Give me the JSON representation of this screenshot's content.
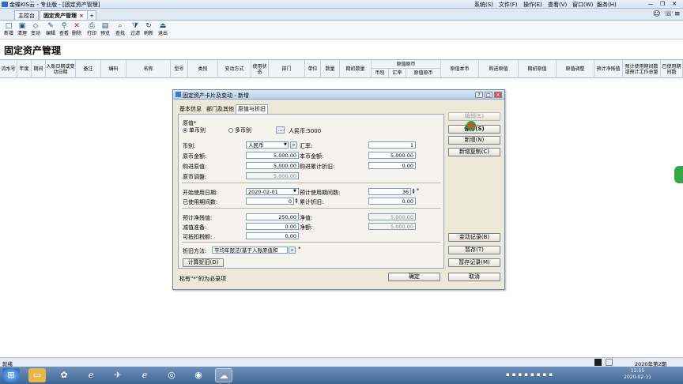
{
  "window": {
    "title": "金蝶KIS云 - 专业版 - [固定资产管理]",
    "menu": [
      "系统(S)",
      "文件(F)",
      "操作(E)",
      "查看(V)",
      "窗口(W)",
      "服务(H)"
    ]
  },
  "tabs": [
    {
      "label": "主控台"
    },
    {
      "label": "固定资产管理",
      "close": "×"
    }
  ],
  "toolbar": [
    {
      "label": "新增",
      "icon": "new-icon"
    },
    {
      "label": "清理",
      "icon": "clear-icon"
    },
    {
      "label": "变动",
      "icon": "change-icon"
    },
    {
      "label": "编辑",
      "icon": "edit-icon"
    },
    {
      "label": "查看",
      "icon": "view-icon"
    },
    {
      "label": "删除",
      "icon": "delete-icon"
    },
    {
      "label": "打印",
      "icon": "print-icon"
    },
    {
      "label": "预览",
      "icon": "preview-icon"
    },
    {
      "label": "查找",
      "icon": "find-icon"
    },
    {
      "label": "过滤",
      "icon": "filter-icon"
    },
    {
      "label": "刷新",
      "icon": "refresh-icon"
    },
    {
      "label": "退出",
      "icon": "exit-icon"
    }
  ],
  "page": {
    "title": "固定资产管理"
  },
  "grid": {
    "columns": [
      "流水号",
      "年度",
      "期间",
      "入账日期或变动日期",
      "备注",
      "编码",
      "名称",
      "型号",
      "类别",
      "变动方式",
      "使用状态",
      "部门",
      "单位",
      "数量",
      "期初数量",
      "原值原币",
      "原值本币",
      "购进原值",
      "期初原值",
      "原值调整",
      "预计净残值",
      "预计使用期间数或预计工作总量",
      "已使用期间数"
    ],
    "sub_columns": [
      "币别",
      "汇率",
      "原值原币"
    ]
  },
  "dialog": {
    "title": "固定资产卡片及变动 - 新增",
    "tabs": [
      "基本信息",
      "部门及其他",
      "原值与折旧"
    ],
    "section_label": "原值*",
    "radio_single": "单币别",
    "radio_multi": "多币别",
    "currency_summary": "人民币:5000",
    "labels": {
      "currency": "币别:",
      "exchange_rate": "汇率:",
      "orig_amount": "原币金额:",
      "local_amount": "本币金额:",
      "purchase_value": "购进原值:",
      "purchase_acc_depr": "购进累计折旧:",
      "value_adjust": "原币调整:",
      "start_date": "开始使用日期:",
      "expected_periods": "预计使用期间数:",
      "used_periods": "已使用期间数:",
      "acc_depr": "累计折旧:",
      "salvage": "预计净残值:",
      "net_value": "净值:",
      "impairment": "减值准备:",
      "net_amount": "净额:",
      "deductible_tax": "可抵扣税额:",
      "depr_method": "折旧方法:"
    },
    "values": {
      "currency": "人民币",
      "exchange_rate": "1",
      "orig_amount": "5,000.00",
      "local_amount": "5,000.00",
      "purchase_value": "5,000.00",
      "purchase_acc_depr": "0.00",
      "value_adjust": "5,000.00",
      "start_date": "2020-02-01",
      "expected_periods": "36",
      "used_periods": "0",
      "acc_depr": "0.00",
      "salvage": "250.00",
      "net_value": "5,000.00",
      "impairment": "0.00",
      "net_amount": "5,000.00",
      "deductible_tax": "0.00",
      "depr_method": "平均年限法(基于入账原值和"
    },
    "calc_button": "计算折旧(D)",
    "buttons": {
      "edit": "编辑(E)",
      "save": "保存(S)",
      "new": "新增(N)",
      "copy_new": "新增复制(C)",
      "change_record": "变动记录(B)",
      "hold": "暂存(T)",
      "hold_record": "暂存记录(M)",
      "cancel": "取消"
    },
    "footer_note": "标有\"*\"的为必录项",
    "ok": "确定"
  },
  "statusbar": {
    "left": "就绪",
    "right": "2020年第2期"
  },
  "taskbar": {
    "time": "12:55",
    "date": "2020-02-11"
  },
  "colors": {
    "accent": "#2f6fc6",
    "taskbar": "#4a6f9c",
    "cursor": "#d84a2e"
  }
}
